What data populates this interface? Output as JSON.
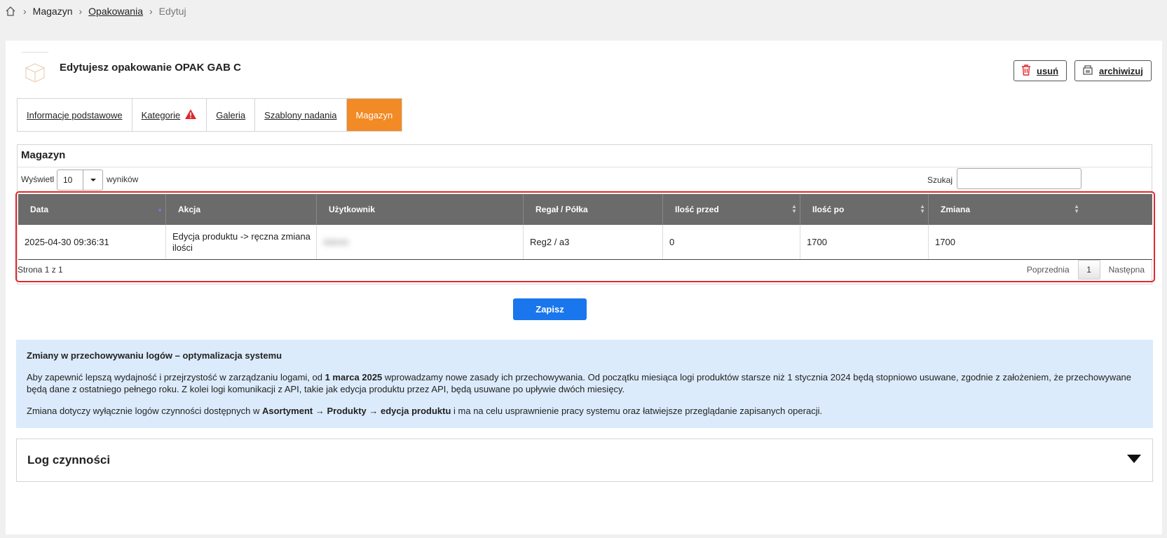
{
  "breadcrumb": {
    "items": [
      {
        "label": "Magazyn"
      },
      {
        "label": "Opakowania"
      },
      {
        "label": "Edytuj"
      }
    ]
  },
  "header": {
    "title": "Edytujesz opakowanie OPAK GAB C",
    "delete_label": "usuń",
    "archive_label": "archiwizuj"
  },
  "tabs": [
    {
      "label": "Informacje podstawowe"
    },
    {
      "label": "Kategorie"
    },
    {
      "label": "Galeria"
    },
    {
      "label": "Szablony nadania"
    },
    {
      "label": "Magazyn"
    }
  ],
  "warehouse": {
    "title": "Magazyn",
    "show_label": "Wyświetl",
    "page_length": "10",
    "results_label": "wyników",
    "search_label": "Szukaj",
    "search_value": "",
    "columns": [
      "Data",
      "Akcja",
      "Użytkownik",
      "Regał / Półka",
      "Ilość przed",
      "Ilość po",
      "Zmiana"
    ],
    "rows": [
      {
        "date": "2025-04-30 09:36:31",
        "action": "Edycja produktu -> ręczna zmiana ilości",
        "user": "Admin",
        "location": "Reg2 / a3",
        "qty_before": "0",
        "qty_after": "1700",
        "change": "1700"
      }
    ],
    "page_info": "Strona 1 z 1",
    "prev_label": "Poprzednia",
    "current_page": "1",
    "next_label": "Następna"
  },
  "save_label": "Zapisz",
  "notice": {
    "title": "Zmiany w przechowywaniu logów – optymalizacja systemu",
    "p1_a": "Aby zapewnić lepszą wydajność i przejrzystość w zarządzaniu logami, od ",
    "p1_bold": "1 marca 2025",
    "p1_b": " wprowadzamy nowe zasady ich przechowywania. Od początku miesiąca logi produktów starsze niż 1 stycznia 2024 będą stopniowo usuwane, zgodnie z założeniem, że przechowywane będą dane z ostatniego pełnego roku. Z kolei logi komunikacji z API, takie jak edycja produktu przez API, będą usuwane po upływie dwóch miesięcy.",
    "p2_a": "Zmiana dotyczy wyłącznie logów czynności dostępnych w ",
    "p2_bold": "Asortyment → Produkty → edycja produktu",
    "p2_b": " i ma na celu usprawnienie pracy systemu oraz łatwiejsze przeglądanie zapisanych operacji."
  },
  "log": {
    "title": "Log czynności"
  },
  "colors": {
    "accent": "#f28a25",
    "primary": "#1a76ec",
    "table_header": "#6b6b6b",
    "highlight": "#e0282e",
    "notice_bg": "#dcebfb",
    "warning": "#e0282e"
  }
}
